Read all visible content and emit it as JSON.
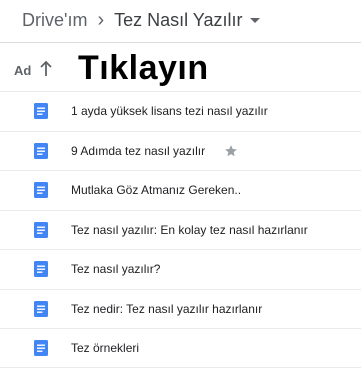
{
  "breadcrumb": {
    "root": "Drive'ım",
    "separator": "›",
    "current": "Tez Nasıl Yazılır"
  },
  "header": {
    "column_name": "Ad",
    "overlay_text": "Tıklayın"
  },
  "colors": {
    "doc_icon": "#4285f4",
    "star": "#9aa0a6",
    "divider": "#e8eaed"
  },
  "files": [
    {
      "name": "1 ayda yüksek lisans tezi nasıl yazılır",
      "icon": "google-docs-icon",
      "starred": false
    },
    {
      "name": "9 Adımda tez nasıl yazılır",
      "icon": "google-docs-icon",
      "starred": true
    },
    {
      "name": "Mutlaka Göz Atmanız Gereken..",
      "icon": "google-docs-icon",
      "starred": false
    },
    {
      "name": "Tez nasıl yazılır: En kolay tez nasıl hazırlanır",
      "icon": "google-docs-icon",
      "starred": false
    },
    {
      "name": "Tez nasıl yazılır?",
      "icon": "google-docs-icon",
      "starred": false
    },
    {
      "name": "Tez nedir: Tez nasıl yazılır hazırlanır",
      "icon": "google-docs-icon",
      "starred": false
    },
    {
      "name": "Tez örnekleri",
      "icon": "google-docs-icon",
      "starred": false
    }
  ]
}
